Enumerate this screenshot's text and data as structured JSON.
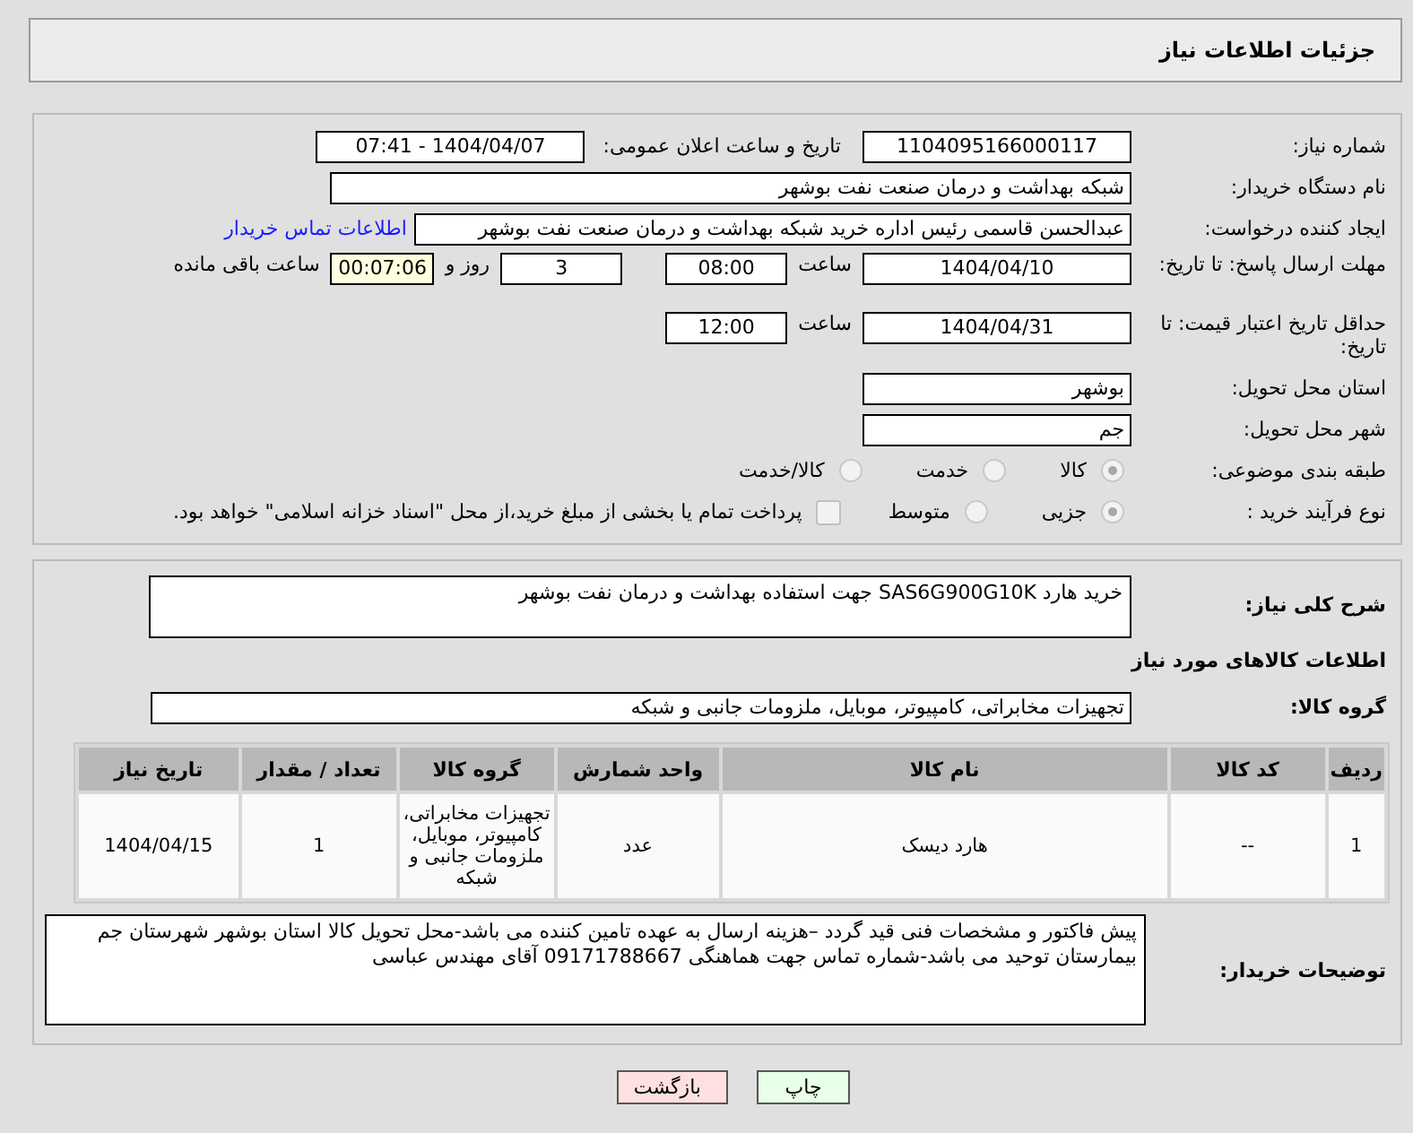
{
  "page_title": "جزئیات اطلاعات نیاز",
  "need_number": {
    "label": "شماره نیاز:",
    "value": "1104095166000117"
  },
  "announce": {
    "label": "تاریخ و ساعت اعلان عمومی:",
    "value": "1404/04/07 - 07:41"
  },
  "buyer_org": {
    "label": "نام دستگاه خریدار:",
    "value": "شبکه بهداشت و درمان صنعت نفت بوشهر"
  },
  "requester": {
    "label": "ایجاد کننده درخواست:",
    "value": "عبدالحسن قاسمی رئیس اداره خرید  شبکه بهداشت و درمان صنعت نفت بوشهر",
    "link": "اطلاعات تماس خریدار"
  },
  "deadline": {
    "label": "مهلت ارسال پاسخ: تا تاریخ:",
    "date": "1404/04/10",
    "time_label": "ساعت",
    "time": "08:00",
    "days": "3",
    "days_label": "روز و",
    "remaining": "00:07:06",
    "remaining_label": "ساعت باقی مانده"
  },
  "validity": {
    "label": "حداقل تاریخ اعتبار قیمت: تا تاریخ:",
    "date": "1404/04/31",
    "time_label": "ساعت",
    "time": "12:00"
  },
  "province": {
    "label": "استان محل تحویل:",
    "value": "بوشهر"
  },
  "city": {
    "label": "شهر محل تحویل:",
    "value": "جم"
  },
  "category": {
    "label": "طبقه بندی موضوعی:",
    "options": [
      {
        "label": "کالا",
        "selected": true
      },
      {
        "label": "خدمت",
        "selected": false
      },
      {
        "label": "کالا/خدمت",
        "selected": false
      }
    ]
  },
  "process": {
    "label": "نوع فرآیند خرید :",
    "options": [
      {
        "label": "جزیی",
        "selected": true
      },
      {
        "label": "متوسط",
        "selected": false
      }
    ],
    "payment_checked": false,
    "payment_text": "پرداخت تمام یا بخشی از مبلغ خرید،از محل \"اسناد خزانه اسلامی\" خواهد بود."
  },
  "description": {
    "label": "شرح کلی نیاز:",
    "value": "خرید هارد SAS6G900G10K جهت استفاده بهداشت و درمان نفت بوشهر"
  },
  "goods_title": "اطلاعات کالاهای مورد نیاز",
  "goods_group": {
    "label": "گروه کالا:",
    "value": "تجهیزات مخابراتی، کامپیوتر، موبایل، ملزومات جانبی و شبکه"
  },
  "table": {
    "columns": [
      "ردیف",
      "کد کالا",
      "نام کالا",
      "واحد شمارش",
      "گروه کالا",
      "تعداد / مقدار",
      "تاریخ نیاز"
    ],
    "rows": [
      [
        "1",
        "--",
        "هارد دیسک",
        "عدد",
        "تجهیزات مخابراتی، کامپیوتر، موبایل، ملزومات جانبی و شبکه",
        "1",
        "1404/04/15"
      ]
    ]
  },
  "buyer_notes": {
    "label": "توضیحات خریدار:",
    "value": "پیش فاکتور و مشخصات فنی قید گردد –هزینه ارسال به عهده تامین کننده می باشد-محل تحویل کالا استان بوشهر شهرستان جم بیمارستان توحید می باشد-شماره تماس جهت هماهنگی 09171788667 آقای مهندس عباسی"
  },
  "buttons": [
    {
      "label": "چاپ",
      "kind": "print"
    },
    {
      "label": "بازگشت",
      "kind": "back"
    }
  ]
}
